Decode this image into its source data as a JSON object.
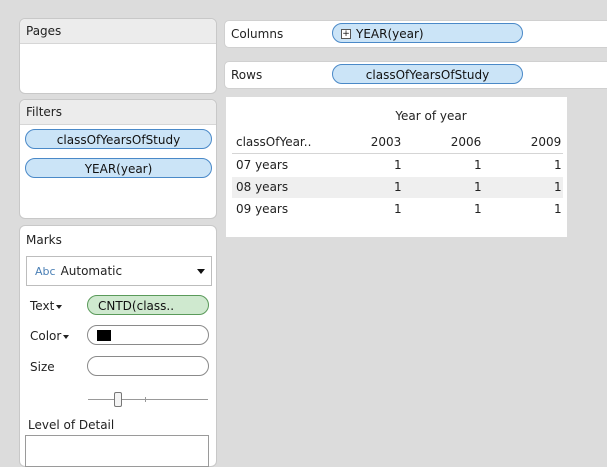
{
  "pages": {
    "title": "Pages"
  },
  "filters": {
    "title": "Filters",
    "items": [
      "classOfYearsOfStudy",
      "YEAR(year)"
    ]
  },
  "marks": {
    "title": "Marks",
    "mark_type": "Automatic",
    "mark_type_icon_text": "Abc",
    "text_label": "Text",
    "text_pill": "CNTD(class..",
    "color_label": "Color",
    "color_swatch": "#000000",
    "size_label": "Size",
    "lod_label": "Level of Detail"
  },
  "columns": {
    "label": "Columns",
    "pill": "YEAR(year)",
    "pill_icon": "plus-box-icon"
  },
  "rows": {
    "label": "Rows",
    "pill": "classOfYearsOfStudy"
  },
  "viz": {
    "column_header": "Year of year",
    "row_header": "classOfYear..",
    "columns": [
      "2003",
      "2006",
      "2009"
    ],
    "rows": [
      {
        "label": "07 years",
        "values": [
          "1",
          "1",
          "1"
        ]
      },
      {
        "label": "08 years",
        "values": [
          "1",
          "1",
          "1"
        ]
      },
      {
        "label": "09 years",
        "values": [
          "1",
          "1",
          "1"
        ]
      }
    ]
  }
}
